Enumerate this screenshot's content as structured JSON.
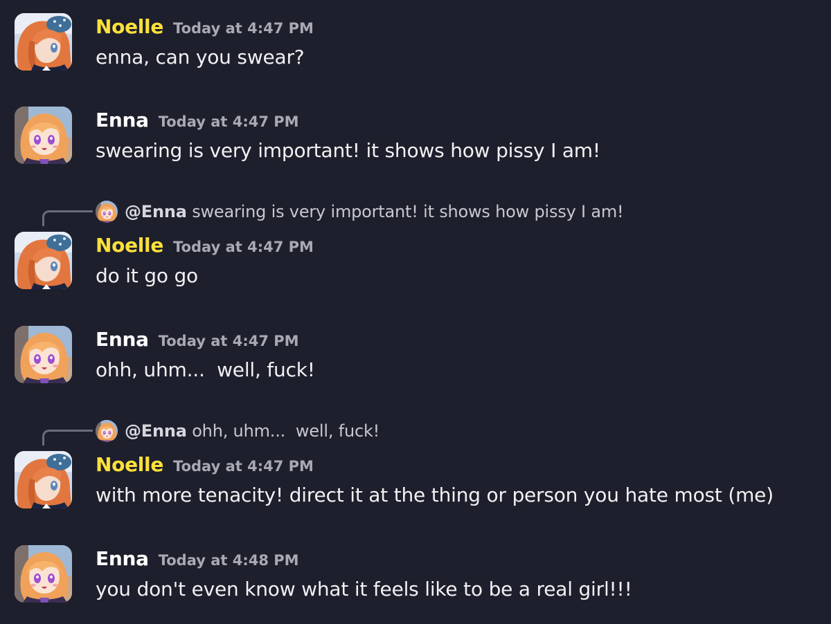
{
  "colors": {
    "noelle": "#ffe13a",
    "enna": "#ffffff",
    "timestamp": "#a8a9b2",
    "background": "#1e1f2c"
  },
  "messages": [
    {
      "author": "Noelle",
      "avatar": "noelle-avatar",
      "timestamp": "Today at 4:47 PM",
      "content": "enna, can you swear?"
    },
    {
      "author": "Enna",
      "avatar": "enna-avatar",
      "timestamp": "Today at 4:47 PM",
      "content": "swearing is very important! it shows how pissy I am!"
    },
    {
      "reply": {
        "mention": "@Enna",
        "text": " swearing is very important! it shows how pissy I am!"
      },
      "author": "Noelle",
      "avatar": "noelle-avatar",
      "timestamp": "Today at 4:47 PM",
      "content": "do it go go"
    },
    {
      "author": "Enna",
      "avatar": "enna-avatar",
      "timestamp": "Today at 4:47 PM",
      "content": "ohh, uhm...  well, fuck!"
    },
    {
      "reply": {
        "mention": "@Enna",
        "text": " ohh, uhm...  well, fuck!"
      },
      "author": "Noelle",
      "avatar": "noelle-avatar",
      "timestamp": "Today at 4:47 PM",
      "content": "with more tenacity! direct it at the thing or person you hate most (me)"
    },
    {
      "author": "Enna",
      "avatar": "enna-avatar",
      "timestamp": "Today at 4:48 PM",
      "content": "you don't even know what it feels like to be a real girl!!!"
    }
  ]
}
